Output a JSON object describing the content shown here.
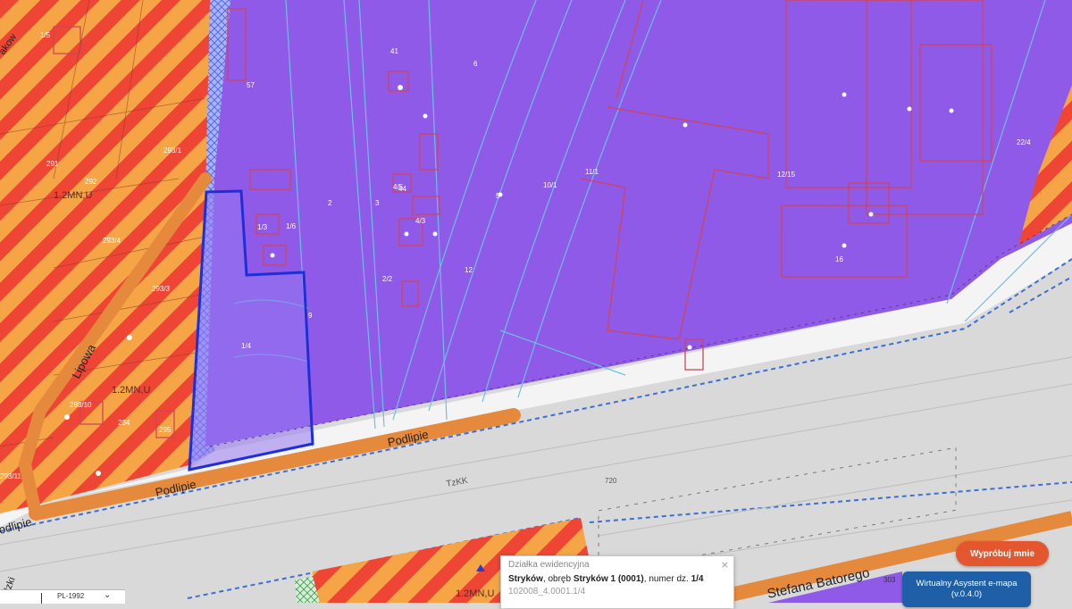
{
  "map": {
    "colors": {
      "background": "#d9d9d9",
      "zone_purple": "#8f5ae8",
      "stripe_red": "#ee4534",
      "stripe_orange": "#f5a545",
      "road_orange": "#e58a3c",
      "parcel_outline": "#6ac0e6",
      "building_outline": "#d0445a",
      "selected_parcel": "#1f2fd8",
      "boundary_dashed": "#3c6fd4"
    },
    "street_labels": {
      "podlipie_1": "Podlipie",
      "podlipie_2": "Podlipie",
      "podlipie_3": "odlipie",
      "lipowa": "Lipowa",
      "stefana_batorego": "Stefana Batorego",
      "krakow": "akow",
      "corner": "odzki"
    },
    "zone_labels": {
      "z1": "1.2MN,U",
      "z2": "1.2MN,U",
      "z3": "1.2MN,U",
      "road": "TzKK"
    },
    "parcel_numbers": {
      "p1": "1/4",
      "p2": "1/3",
      "p3": "1/6",
      "p4": "2",
      "p5": "3",
      "p6": "4/5",
      "p7": "4/3",
      "p8": "41",
      "p9": "6",
      "p10": "5",
      "p11": "10/1",
      "p12": "11/1",
      "p13": "12/15",
      "p14": "12",
      "p15": "2/2",
      "p16": "9",
      "p17": "291",
      "p18": "292",
      "p19": "293/1",
      "p20": "293/4",
      "p21": "293/3",
      "p22": "293/10",
      "p23": "294",
      "p24": "295",
      "p25": "720",
      "p26": "57",
      "p27": "22/4",
      "p28": "293/11",
      "p29": "16",
      "p30": "1/5",
      "p31": "44",
      "p32": "303"
    }
  },
  "info_popup": {
    "title": "Działka ewidencyjna",
    "place": "Stryków",
    "precinct_prefix": ", obręb ",
    "precinct": "Stryków 1 (0001)",
    "number_prefix": ", numer dz. ",
    "number": "1/4",
    "identifier": "102008_4.0001.1/4",
    "close_icon": "⨯"
  },
  "buttons": {
    "try_label": "Wypróbuj mnie",
    "assistant_line1": "Wirtualny Asystent e-mapa",
    "assistant_line2": "(v.0.4.0)"
  },
  "crs": {
    "selected": "PL-1992",
    "chevron": "⌄"
  }
}
